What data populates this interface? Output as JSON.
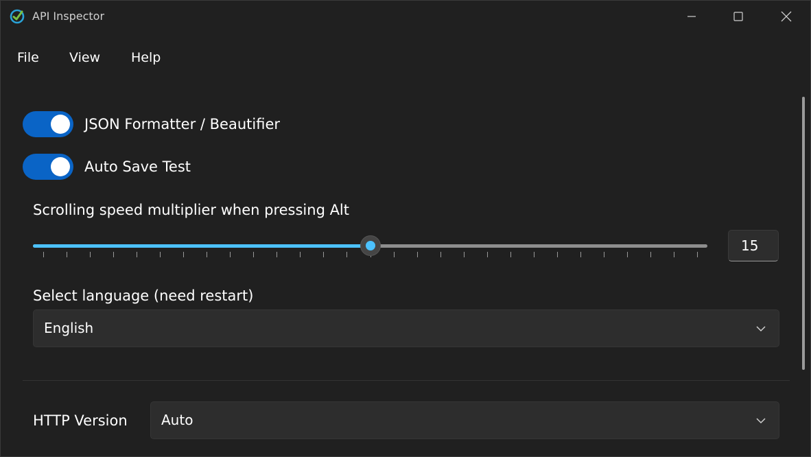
{
  "window": {
    "title": "API Inspector",
    "app_icon": "check-circle-icon",
    "controls": [
      "minimize-icon",
      "maximize-icon",
      "close-icon"
    ]
  },
  "menu": {
    "items": [
      {
        "label": "File"
      },
      {
        "label": "View"
      },
      {
        "label": "Help"
      }
    ]
  },
  "settings": {
    "json_formatter": {
      "label": "JSON Formatter / Beautifier",
      "enabled": true
    },
    "auto_save": {
      "label": "Auto Save Test",
      "enabled": true
    },
    "scroll_speed": {
      "label": "Scrolling speed multiplier when pressing Alt",
      "value": "15",
      "min": 1,
      "max": 29,
      "value_num": 15,
      "tick_count": 28
    },
    "language": {
      "label": "Select language (need restart)",
      "selected": "English"
    },
    "http_version": {
      "label": "HTTP Version",
      "selected": "Auto"
    }
  },
  "colors": {
    "accent": "#0a64c6",
    "slider_accent": "#4cc2ff",
    "background": "#202020",
    "control_bg": "#2d2d2d"
  }
}
